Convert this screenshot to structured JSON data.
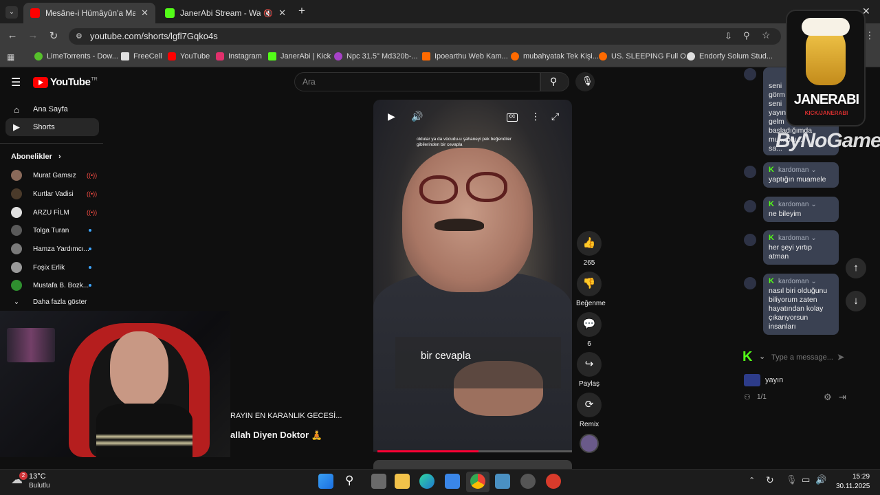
{
  "browser": {
    "tabs": [
      {
        "title": "Mesâne-i Hümâyûn'a Maşallah",
        "close": "✕",
        "color": "#ff0000"
      },
      {
        "title": "JanerAbi Stream - Watch Li",
        "close": "✕",
        "color": "#53fc18"
      }
    ],
    "new_tab": "+",
    "url": "youtube.com/shorts/lgfl7Gqko4s",
    "bookmarks": [
      {
        "label": "LimeTorrents - Dow...",
        "color": "#56c02b"
      },
      {
        "label": "FreeCell",
        "color": "#e0e0e0"
      },
      {
        "label": "YouTube",
        "color": "#ff0000"
      },
      {
        "label": "Instagram",
        "color": "#e1306c"
      },
      {
        "label": "JanerAbi | Kick",
        "color": "#53fc18"
      },
      {
        "label": "Npc 31.5\" Md320b-...",
        "color": "#a742c8"
      },
      {
        "label": "Ipoearthu Web Kam...",
        "color": "#ff6a00"
      },
      {
        "label": "mubahyatak Tek Kişi...",
        "color": "#ff6a00"
      },
      {
        "label": "US. SLEEPING Full O...",
        "color": "#ff6a00"
      },
      {
        "label": "Endorfy Solum Stud...",
        "color": "#dddddd"
      }
    ]
  },
  "youtube": {
    "logo_text": "YouTube",
    "logo_tr": "TR",
    "search_placeholder": "Ara",
    "sidebar": [
      {
        "label": "Ana Sayfa",
        "icon": "⌂"
      },
      {
        "label": "Shorts",
        "icon": "▶"
      }
    ],
    "subscriptions_title": "Abonelikler",
    "subscriptions": [
      {
        "name": "Murat Gamsız",
        "status": "live",
        "color": "#8a6a5a"
      },
      {
        "name": "Kurtlar Vadisi",
        "status": "live",
        "color": "#4a3a2a"
      },
      {
        "name": "ARZU FİLM",
        "status": "live",
        "color": "#e0e0e0"
      },
      {
        "name": "Tolga Turan",
        "status": "new",
        "color": "#5a5a5a"
      },
      {
        "name": "Hamza Yardımcı...",
        "status": "new",
        "color": "#7a7a7a"
      },
      {
        "name": "Foşix Erlik",
        "status": "new",
        "color": "#9a9a9a"
      },
      {
        "name": "Mustafa B. Bozk...",
        "status": "new",
        "color": "#2f8f2f"
      }
    ],
    "show_more": "Daha fazla göster",
    "video": {
      "caption_top": "oldular ya da vücudu-u şahaneyi pek beğendiler gibilerinden bir cevapla",
      "subtitle": "bir cevapla",
      "progress": 0.52
    },
    "actions": [
      {
        "icon": "👍",
        "label": "265"
      },
      {
        "icon": "👎",
        "label": "Beğenme"
      },
      {
        "icon": "💬",
        "label": "6"
      },
      {
        "icon": "↪",
        "label": "Paylaş"
      },
      {
        "icon": "⟳",
        "label": "Remix"
      }
    ],
    "title_line1": "RAYIN EN KARANLIK GECESİ...",
    "title_line2": "allah Diyen Doktor 🧘"
  },
  "chat": {
    "messages": [
      {
        "user": "kardoman",
        "text": "yaptığın muamele"
      },
      {
        "user": "kardoman",
        "text": "ne bileyim"
      },
      {
        "user": "kardoman",
        "text": "her şeyi yırtıp atman"
      },
      {
        "user": "kardoman",
        "text": "nasıl biri olduğunu biliyorum zaten hayatından kolay çıkarıyorsun insanları"
      }
    ],
    "partial_lines": [
      "seni",
      "görm",
      "seni",
      "yayın",
      "gelm",
      "başladığımda",
      "mu... olu...",
      "sa..."
    ],
    "input_placeholder": "Type a message...",
    "yayin_label": "yayın",
    "count": "1/1",
    "overlay_logo": "JANERABI",
    "overlay_logo_sub": "KICK/JANERABI",
    "bynogame": "ByNoGame"
  },
  "taskbar": {
    "weather_temp": "13°C",
    "weather_desc": "Bulutlu",
    "weather_badge": "2",
    "time": "15:29",
    "date": "30.11.2025"
  }
}
